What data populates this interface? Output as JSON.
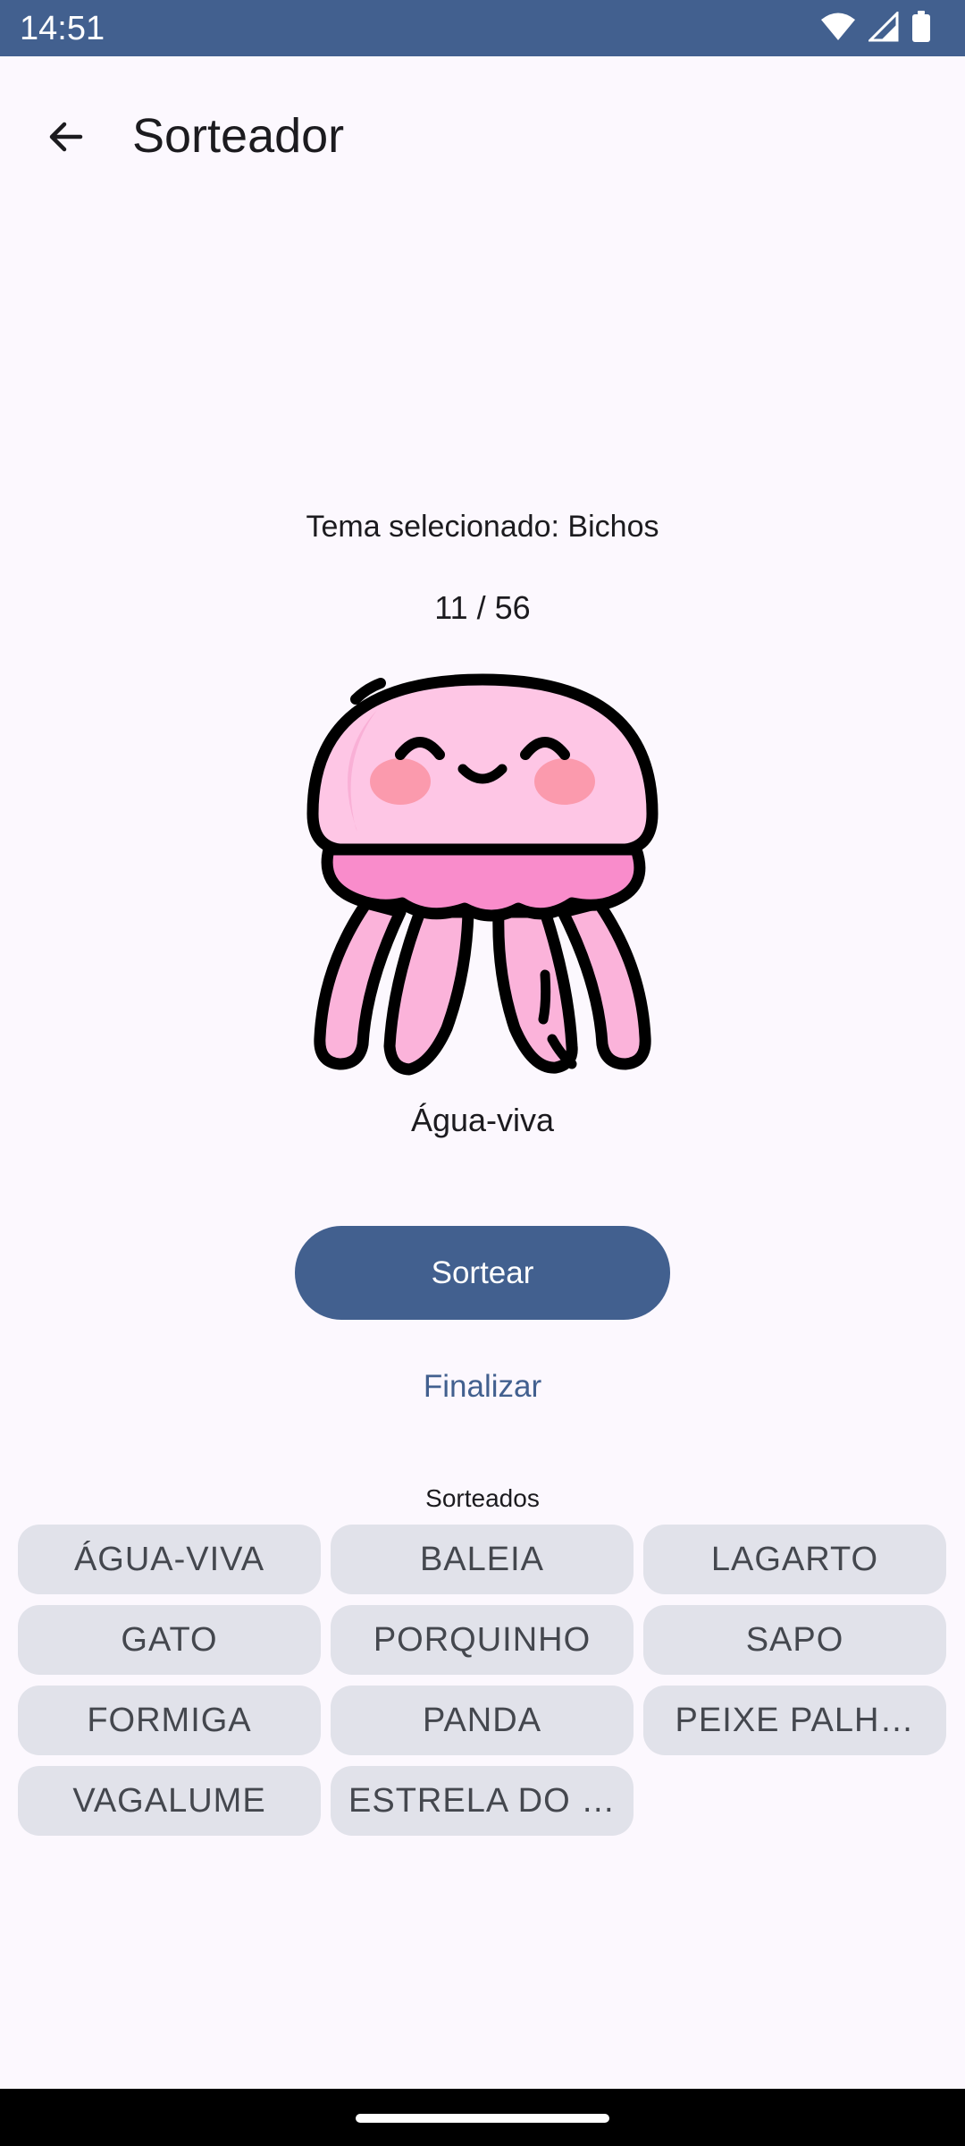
{
  "status_bar": {
    "time": "14:51",
    "icons": [
      "wifi-icon",
      "signal-icon",
      "battery-icon"
    ]
  },
  "app_bar": {
    "back_icon": "arrow-back-icon",
    "title": "Sorteador"
  },
  "main": {
    "theme_label": "Tema selecionado: Bichos",
    "counter": "11 / 56",
    "image_icon": "jellyfish-illustration",
    "item_name": "Água-viva",
    "draw_button": "Sortear",
    "finish_button": "Finalizar"
  },
  "drawn": {
    "label": "Sorteados",
    "items": [
      "ÁGUA-VIVA",
      "BALEIA",
      "LAGARTO",
      "GATO",
      "PORQUINHO",
      "SAPO",
      "FORMIGA",
      "PANDA",
      "PEIXE PALH…",
      "VAGALUME",
      "ESTRELA DO …"
    ]
  },
  "colors": {
    "primary": "#42608f",
    "background": "#fcf8fe",
    "chip": "#e1e2ea",
    "jelly_pink": "#fec6e5",
    "jelly_skirt": "#f98ccb"
  }
}
